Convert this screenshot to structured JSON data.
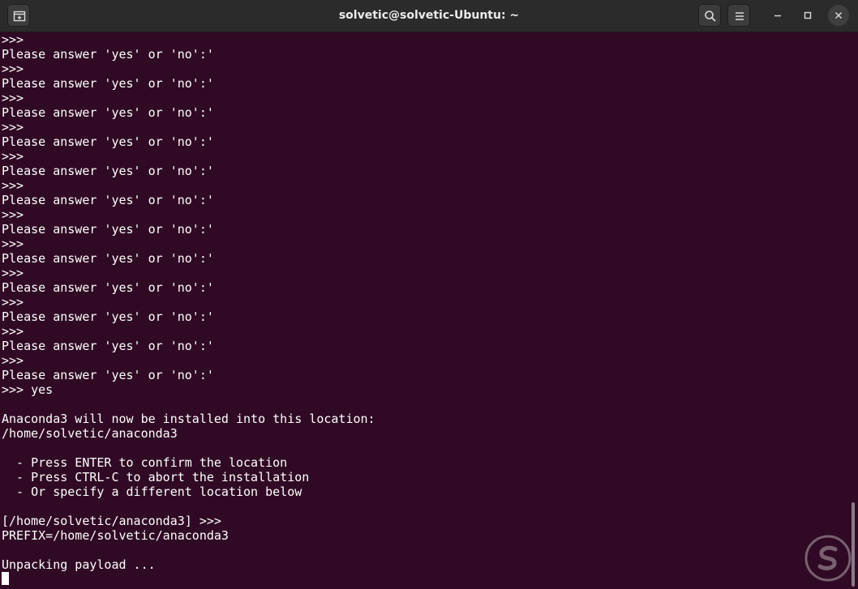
{
  "window": {
    "title": "solvetic@solvetic-Ubuntu: ~",
    "colors": {
      "terminal_bg": "#300a24",
      "titlebar_bg": "#2b2b2b",
      "text": "#ffffff"
    },
    "buttons": {
      "new_tab": "new-tab-icon",
      "search": "search-icon",
      "menu": "hamburger-menu-icon",
      "minimize": "minimize-icon",
      "maximize": "maximize-icon",
      "close": "close-icon"
    }
  },
  "terminal": {
    "lines": [
      ">>>",
      "Please answer 'yes' or 'no':'",
      ">>>",
      "Please answer 'yes' or 'no':'",
      ">>>",
      "Please answer 'yes' or 'no':'",
      ">>>",
      "Please answer 'yes' or 'no':'",
      ">>>",
      "Please answer 'yes' or 'no':'",
      ">>>",
      "Please answer 'yes' or 'no':'",
      ">>>",
      "Please answer 'yes' or 'no':'",
      ">>>",
      "Please answer 'yes' or 'no':'",
      ">>>",
      "Please answer 'yes' or 'no':'",
      ">>>",
      "Please answer 'yes' or 'no':'",
      ">>>",
      "Please answer 'yes' or 'no':'",
      ">>>",
      "Please answer 'yes' or 'no':'",
      ">>> yes",
      "",
      "Anaconda3 will now be installed into this location:",
      "/home/solvetic/anaconda3",
      "",
      "  - Press ENTER to confirm the location",
      "  - Press CTRL-C to abort the installation",
      "  - Or specify a different location below",
      "",
      "[/home/solvetic/anaconda3] >>>",
      "PREFIX=/home/solvetic/anaconda3",
      "",
      "Unpacking payload ..."
    ],
    "scroll_position": 1.0
  }
}
